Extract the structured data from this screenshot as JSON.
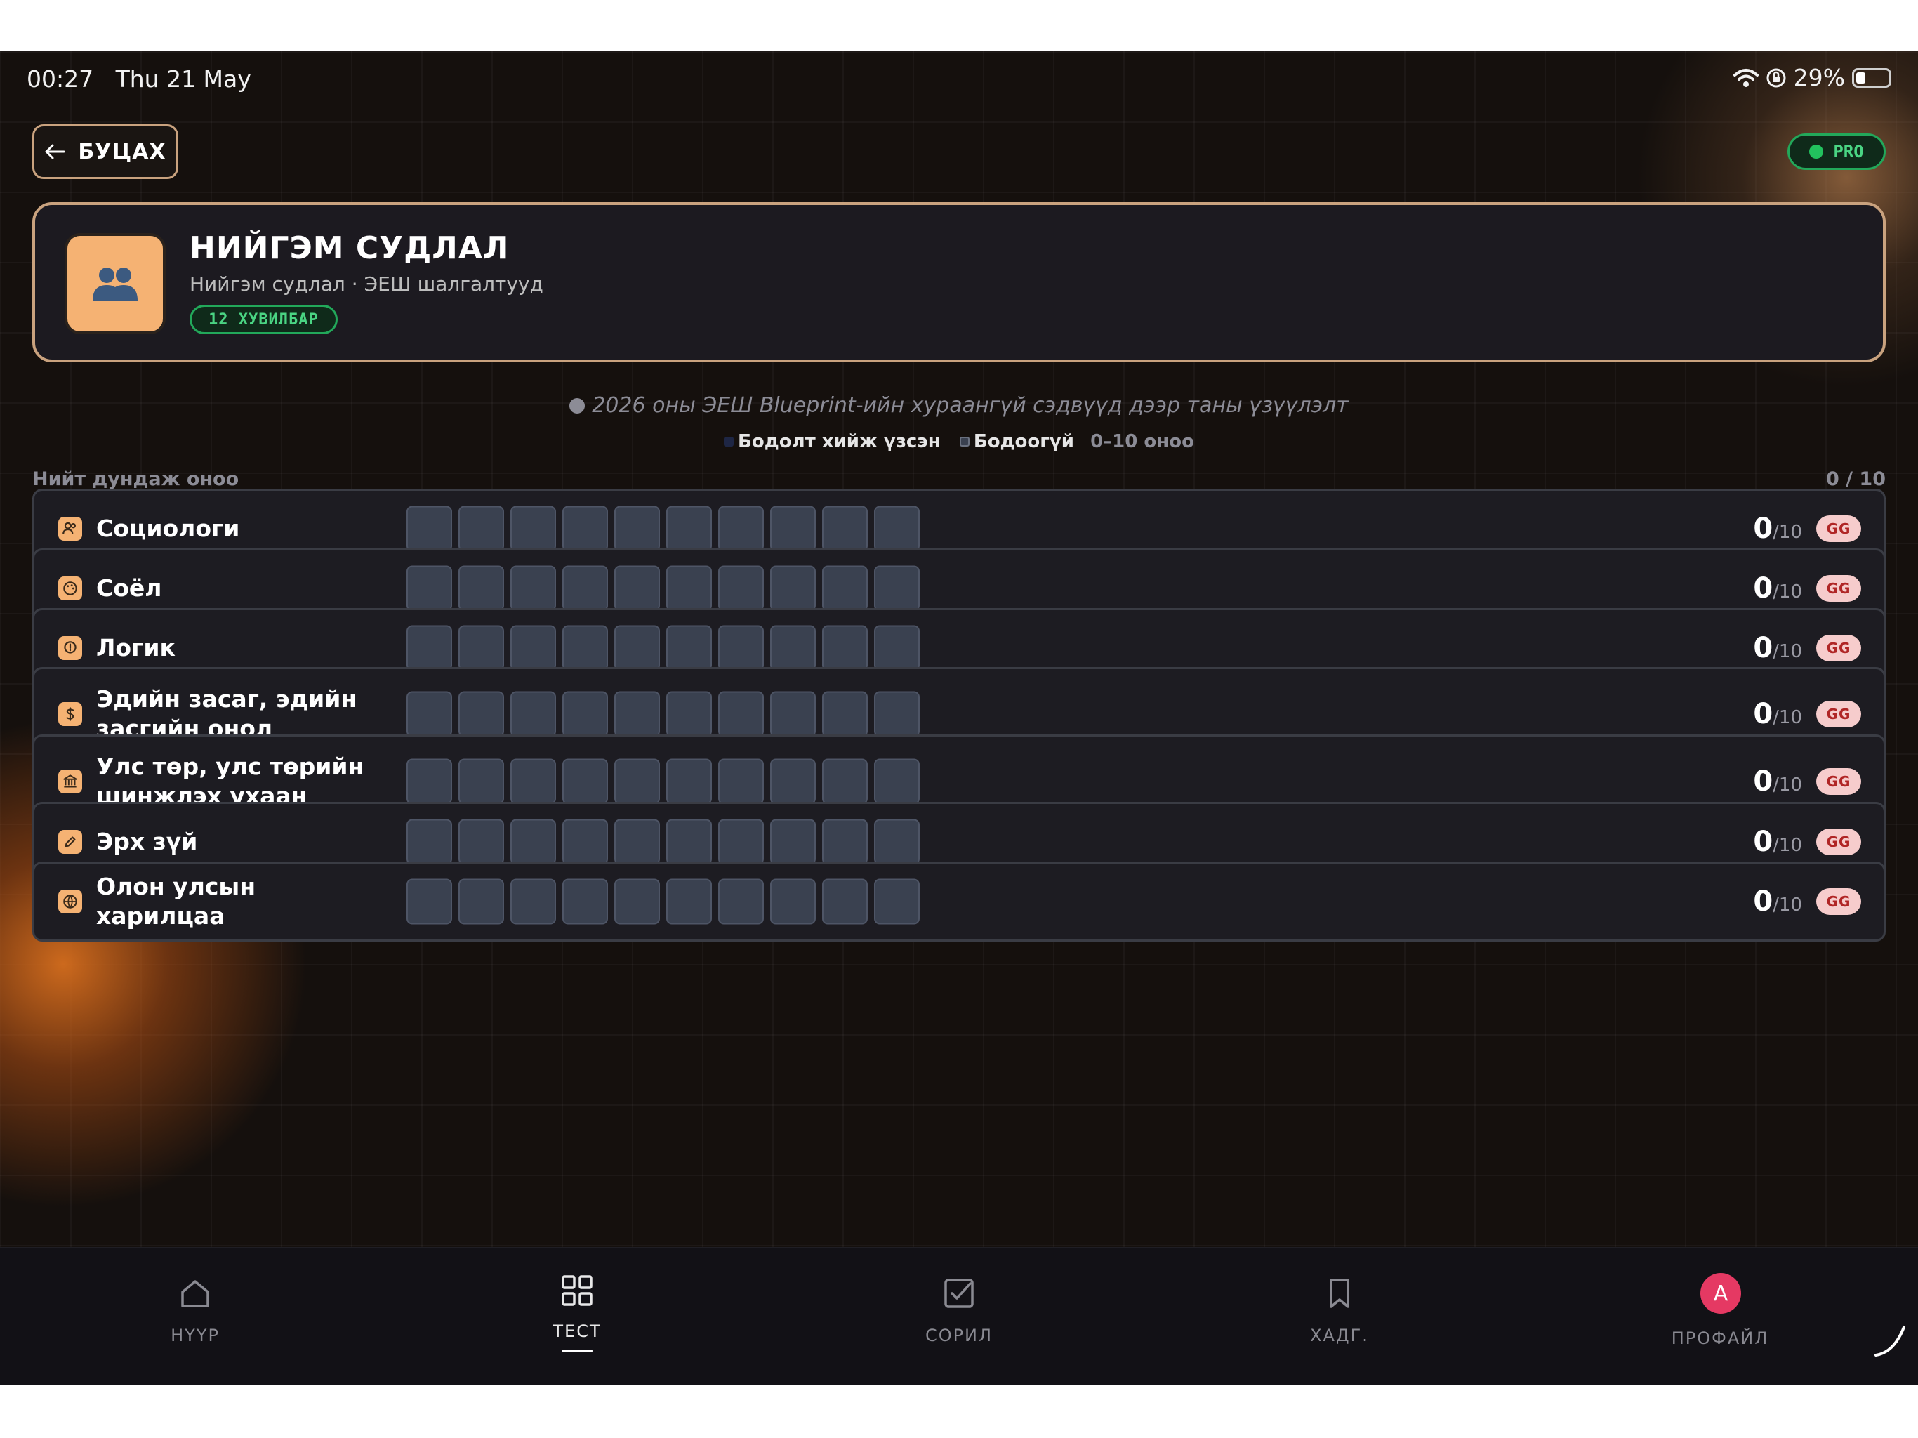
{
  "status_bar": {
    "time": "00:27",
    "date": "Thu 21 May",
    "battery": "29%",
    "battery_level": 0.29
  },
  "header": {
    "back_label": "БУЦАХ",
    "pro_label": "PRO"
  },
  "subject": {
    "title": "НИЙГЭМ СУДЛАЛ",
    "subtitle": "Нийгэм судлал · ЭЕШ шалгалтууд",
    "variants_label": "12 ХУВИЛБАР",
    "avatar_icon": "people-icon",
    "avatar_color": "#f5b273"
  },
  "info": {
    "text": "2026 оны ЭЕШ Blueprint-ийн хураангүй сэдвүүд дээр таны үзүүлэлт",
    "legend_done": "Бодолт хийж үзсэн",
    "legend_todo": "Бодоогүй",
    "legend_range": "0–10 оноо"
  },
  "average": {
    "label": "Нийт дундаж оноо",
    "value": "0 / 10",
    "fraction": 0
  },
  "topics": [
    {
      "name": "Социологи",
      "icon": "users-icon",
      "score": "0",
      "max": "/10",
      "badge": "GG",
      "filled": 0,
      "total": 10
    },
    {
      "name": "Соёл",
      "icon": "palette-icon",
      "score": "0",
      "max": "/10",
      "badge": "GG",
      "filled": 0,
      "total": 10
    },
    {
      "name": "Логик",
      "icon": "lightbulb-icon",
      "score": "0",
      "max": "/10",
      "badge": "GG",
      "filled": 0,
      "total": 10
    },
    {
      "name": "Эдийн засаг, эдийн засгийн онол",
      "icon": "dollar-icon",
      "score": "0",
      "max": "/10",
      "badge": "GG",
      "filled": 0,
      "total": 10
    },
    {
      "name": "Улс төр, улс төрийн шинжлэх ухаан",
      "icon": "bank-icon",
      "score": "0",
      "max": "/10",
      "badge": "GG",
      "filled": 0,
      "total": 10
    },
    {
      "name": "Эрх зүй",
      "icon": "pencil-icon",
      "score": "0",
      "max": "/10",
      "badge": "GG",
      "filled": 0,
      "total": 10
    },
    {
      "name": "Олон улсын харилцаа",
      "icon": "globe-icon",
      "score": "0",
      "max": "/10",
      "badge": "GG",
      "filled": 0,
      "total": 10
    }
  ],
  "nav": [
    {
      "label": "НҮҮР",
      "icon": "home-icon"
    },
    {
      "label": "ТЕСТ",
      "icon": "grid-icon",
      "active": true
    },
    {
      "label": "СОРИЛ",
      "icon": "checkbox-icon"
    },
    {
      "label": "ХАДГ.",
      "icon": "bookmark-icon"
    },
    {
      "label": "ПРОФАЙЛ",
      "icon": "avatar",
      "avatar_letter": "A"
    }
  ],
  "colors": {
    "accent": "#c9a27e",
    "pro_green": "#22a85a",
    "cell_empty": "#3a4150",
    "badge_red": "#b02626"
  }
}
